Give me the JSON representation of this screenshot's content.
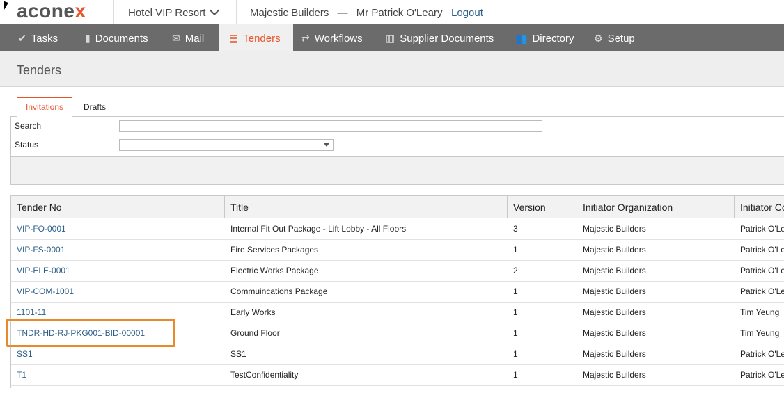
{
  "header": {
    "logo_text": "aconex",
    "project": "Hotel VIP Resort",
    "organization": "Majestic Builders",
    "separator": "—",
    "user": "Mr Patrick O'Leary",
    "logout": "Logout"
  },
  "nav": {
    "items": [
      {
        "label": "Tasks",
        "icon": "check-icon"
      },
      {
        "label": "Documents",
        "icon": "document-icon"
      },
      {
        "label": "Mail",
        "icon": "mail-icon"
      },
      {
        "label": "Tenders",
        "icon": "tender-icon",
        "active": true
      },
      {
        "label": "Workflows",
        "icon": "workflow-icon"
      },
      {
        "label": "Supplier Documents",
        "icon": "supplier-icon"
      },
      {
        "label": "Directory",
        "icon": "people-icon"
      },
      {
        "label": "Setup",
        "icon": "gear-icon"
      }
    ]
  },
  "page": {
    "title": "Tenders"
  },
  "tabs": [
    {
      "label": "Invitations",
      "active": true
    },
    {
      "label": "Drafts"
    }
  ],
  "filters": {
    "search_label": "Search",
    "search_value": "",
    "status_label": "Status",
    "status_value": ""
  },
  "table": {
    "columns": [
      "Tender No",
      "Title",
      "Version",
      "Initiator Organization",
      "Initiator Co"
    ],
    "rows": [
      [
        "VIP-FO-0001",
        "Internal Fit Out Package - Lift Lobby - All Floors",
        "3",
        "Majestic Builders",
        "Patrick O'Le"
      ],
      [
        "VIP-FS-0001",
        "Fire Services Packages",
        "1",
        "Majestic Builders",
        "Patrick O'Le"
      ],
      [
        "VIP-ELE-0001",
        "Electric Works Package",
        "2",
        "Majestic Builders",
        "Patrick O'Le"
      ],
      [
        "VIP-COM-1001",
        "Commuincations Package",
        "1",
        "Majestic Builders",
        "Patrick O'Le"
      ],
      [
        "1101-11",
        "Early Works",
        "1",
        "Majestic Builders",
        "Tim Yeung"
      ],
      [
        "TNDR-HD-RJ-PKG001-BID-00001",
        "Ground Floor",
        "1",
        "Majestic Builders",
        "Tim Yeung"
      ],
      [
        "SS1",
        "SS1",
        "1",
        "Majestic Builders",
        "Patrick O'Le"
      ],
      [
        "T1",
        "TestConfidentiality",
        "1",
        "Majestic Builders",
        "Patrick O'Le"
      ]
    ]
  },
  "colors": {
    "accent": "#e8542a",
    "link": "#2d5f8a",
    "nav_bg": "#6b6b6b",
    "highlight": "#e8892a"
  }
}
